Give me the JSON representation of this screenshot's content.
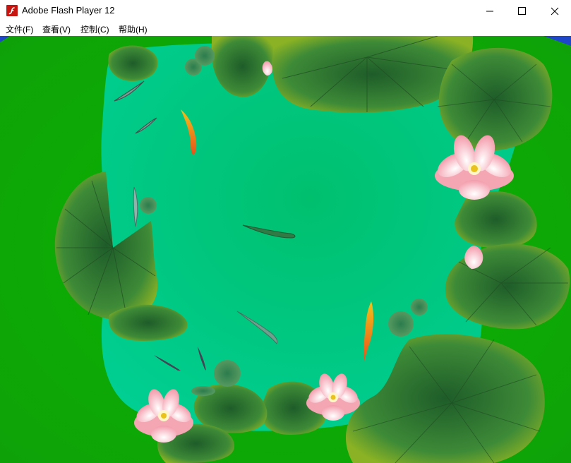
{
  "window": {
    "title": "Adobe Flash Player 12",
    "app_icon": "flash-player-icon",
    "controls": {
      "minimize": "minimize-icon",
      "maximize": "maximize-icon",
      "close": "close-icon"
    }
  },
  "menu": {
    "items": [
      {
        "label": "文件(F)"
      },
      {
        "label": "查看(V)"
      },
      {
        "label": "控制(C)"
      },
      {
        "label": "帮助(H)"
      }
    ]
  },
  "stage": {
    "scene": "lotus-pond-animation",
    "colors": {
      "bank": "#0ab000",
      "water": "#00c57a",
      "pad": "#2f7a2c",
      "lotus": "#f6a8b3",
      "koi": "#f2a41a"
    }
  }
}
